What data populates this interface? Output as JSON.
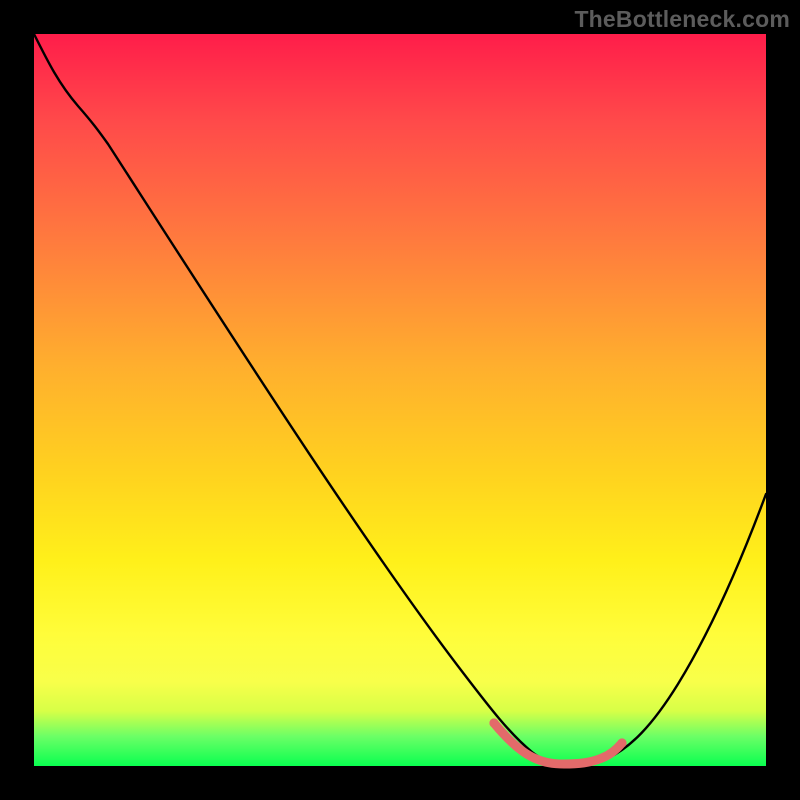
{
  "watermark": "TheBottleneck.com",
  "colors": {
    "page_bg": "#000000",
    "curve": "#000000",
    "highlight": "#e36a6a",
    "gradient_top": "#ff1d4a",
    "gradient_bottom": "#0aff50"
  },
  "chart_data": {
    "type": "line",
    "title": "",
    "xlabel": "",
    "ylabel": "",
    "xlim": [
      0,
      100
    ],
    "ylim": [
      0,
      100
    ],
    "series": [
      {
        "name": "bottleneck-curve",
        "x": [
          0,
          4,
          8,
          12,
          20,
          30,
          40,
          50,
          58,
          62,
          66,
          70,
          74,
          78,
          82,
          88,
          94,
          100
        ],
        "y": [
          100,
          95,
          91,
          88,
          77,
          63,
          49,
          35,
          23,
          15,
          8,
          3,
          0.6,
          0.5,
          2,
          9,
          21,
          37
        ]
      }
    ],
    "highlight_segment": {
      "x_start": 62,
      "x_end": 78,
      "description": "optimal / zero-bottleneck band traced along the curve bottom"
    },
    "annotations": []
  }
}
